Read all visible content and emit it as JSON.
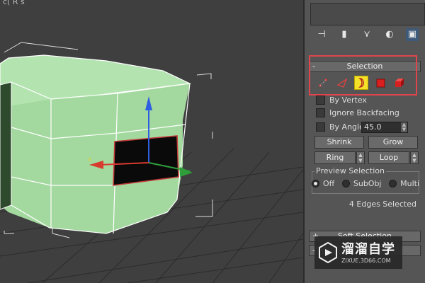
{
  "viewport": {
    "title": "c( R   s    "
  },
  "command_panel": {
    "tabs": [
      {
        "icon": "create-icon"
      },
      {
        "icon": "modify-icon"
      },
      {
        "icon": "hierarchy-icon"
      },
      {
        "icon": "motion-icon"
      },
      {
        "icon": "utilities-icon"
      }
    ]
  },
  "selection": {
    "header": "Selection",
    "collapse_sign": "-",
    "levels": [
      {
        "icon": "vertex-icon",
        "active": false
      },
      {
        "icon": "edge-icon",
        "active": false
      },
      {
        "icon": "border-icon",
        "active": true
      },
      {
        "icon": "polygon-icon",
        "active": false
      },
      {
        "icon": "element-icon",
        "active": false
      }
    ],
    "by_vertex": "By Vertex",
    "ignore_backfacing": "Ignore Backfacing",
    "by_angle": "By Angle:",
    "angle_value": "45.0",
    "shrink": "Shrink",
    "grow": "Grow",
    "ring": "Ring",
    "loop": "Loop",
    "preview": {
      "label": "Preview Selection",
      "options": [
        "Off",
        "SubObj",
        "Multi"
      ],
      "selected": "Off"
    },
    "status": "4 Edges Selected"
  },
  "soft_selection": {
    "header": "Soft Selection",
    "collapse_sign": "+"
  },
  "next_rollout": {
    "collapse_sign": "-"
  },
  "watermark": {
    "name": "溜溜自学",
    "url": "ZIXUE.3D66.COM"
  },
  "colors": {
    "highlight_box": "#e0454d",
    "active_level": "#f5e12a",
    "mesh_fill": "#a6dca2"
  }
}
